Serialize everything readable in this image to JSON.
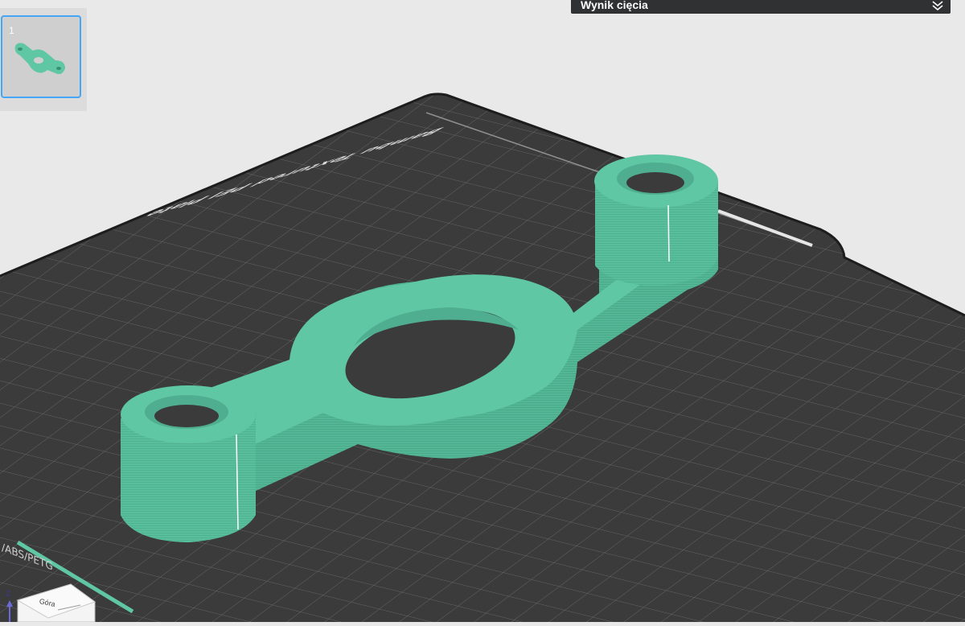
{
  "result_panel": {
    "title": "Wynik cięcia",
    "icon": "double-chevron-down-icon"
  },
  "plate_list": {
    "plates": [
      {
        "index": "1",
        "selected": true
      }
    ]
  },
  "build_plate": {
    "name": "Bambu Textured PEI Plate",
    "filament_label": "/ABS/PETG"
  },
  "nav_cube": {
    "face_label": "Góra",
    "axis_label": "Z"
  },
  "colors": {
    "background": "#e9e9e9",
    "plate": "#3b3b3b",
    "grid": "#7a7a7a",
    "model": "#5fc7a4",
    "accent": "#45a6f5",
    "panel": "#2f3133"
  }
}
